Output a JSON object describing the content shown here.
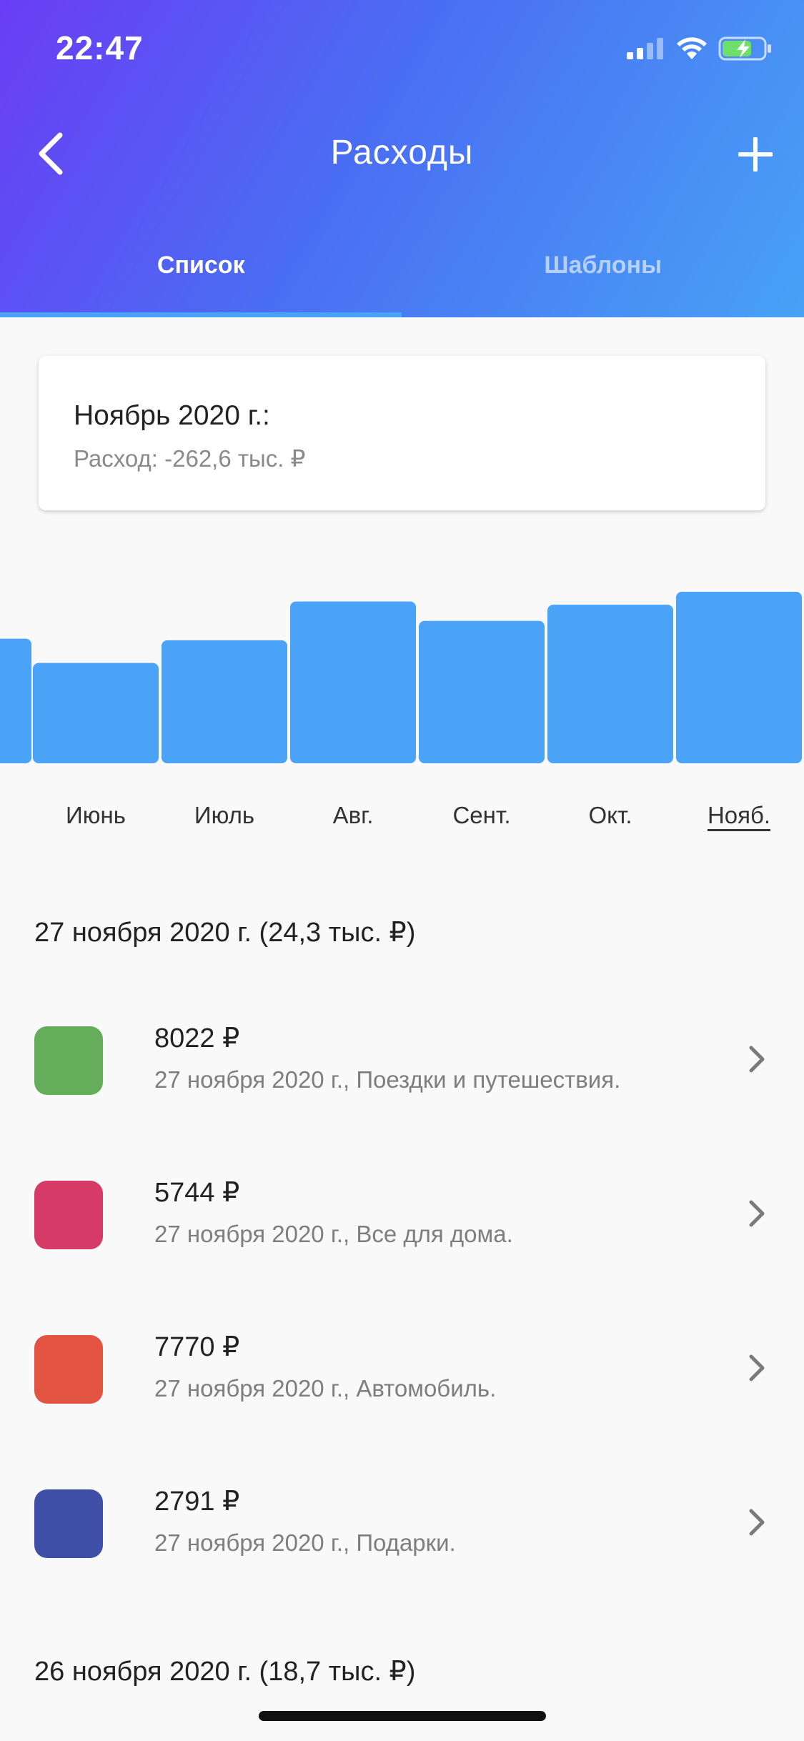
{
  "status_bar": {
    "time": "22:47"
  },
  "nav": {
    "title": "Расходы"
  },
  "tabs": [
    {
      "label": "Список",
      "active": true
    },
    {
      "label": "Шаблоны",
      "active": false
    }
  ],
  "summary": {
    "title": "Ноябрь 2020 г.:",
    "subtitle": "Расход: -262,6 тыс. ₽"
  },
  "chart_data": {
    "type": "bar",
    "categories": [
      "Июнь",
      "Июль",
      "Авг.",
      "Сент.",
      "Окт.",
      "Нояб."
    ],
    "values": [
      0.62,
      0.76,
      1.0,
      0.88,
      0.98,
      1.06
    ],
    "partial_previous_value": 0.77,
    "selected": "Нояб.",
    "bar_color": "#4aa3f7",
    "grid": false,
    "title": "",
    "xlabel": "",
    "ylabel": ""
  },
  "days": [
    {
      "header": "27 ноября 2020 г. (24,3 тыс. ₽)",
      "items": [
        {
          "amount": "8022 ₽",
          "desc": "27 ноября 2020 г., Поездки и путешествия.",
          "color": "#66ad5b"
        },
        {
          "amount": "5744 ₽",
          "desc": "27 ноября 2020 г., Все для дома.",
          "color": "#d63a66"
        },
        {
          "amount": "7770 ₽",
          "desc": "27 ноября 2020 г., Автомобиль.",
          "color": "#e25341"
        },
        {
          "amount": "2791 ₽",
          "desc": "27 ноября 2020 г., Подарки.",
          "color": "#3f4fa8"
        }
      ]
    },
    {
      "header": "26 ноября 2020 г. (18,7 тыс. ₽)",
      "items": []
    }
  ],
  "colors": {
    "accent": "#48a2f6",
    "header_start": "#6a3cf5",
    "header_end": "#48a2f6"
  },
  "icons": {
    "back": "back-arrow-icon",
    "add": "plus-icon",
    "chevron": "chevron-right-icon",
    "signal": "signal-icon",
    "wifi": "wifi-icon",
    "battery": "battery-charging-icon"
  }
}
